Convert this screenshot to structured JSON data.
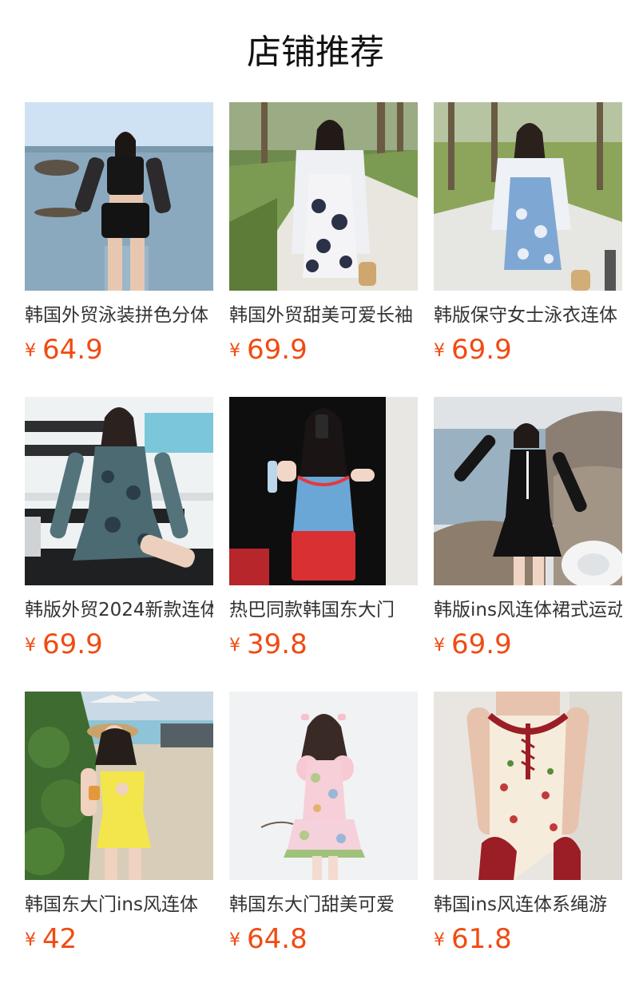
{
  "page": {
    "title": "店铺推荐",
    "currency": "¥"
  },
  "products": [
    {
      "name": "韩国外贸泳装拼色分体",
      "price": "64.9"
    },
    {
      "name": "韩国外贸甜美可爱长袖",
      "price": "69.9"
    },
    {
      "name": "韩版保守女士泳衣连体",
      "price": "69.9"
    },
    {
      "name": "韩版外贸2024新款连体",
      "price": "69.9"
    },
    {
      "name": "热巴同款韩国东大门",
      "price": "39.8"
    },
    {
      "name": "韩版ins风连体裙式运动",
      "price": "69.9"
    },
    {
      "name": "韩国东大门ins风连体",
      "price": "42"
    },
    {
      "name": "韩国东大门甜美可爱",
      "price": "64.8"
    },
    {
      "name": "韩国ins风连体系绳游",
      "price": "61.8"
    }
  ]
}
